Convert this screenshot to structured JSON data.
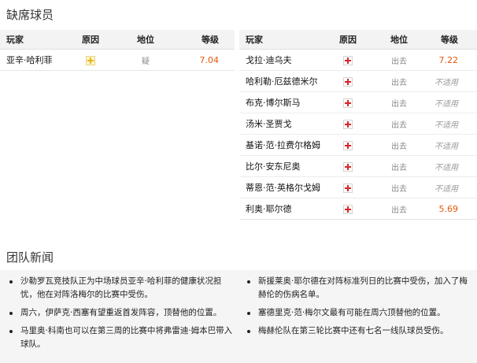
{
  "missing": {
    "title": "缺席球员",
    "headers": {
      "player": "玩家",
      "reason": "原因",
      "status": "地位",
      "rating": "等级"
    },
    "left": [
      {
        "name": "亚辛·哈利菲",
        "reason_icon": "yellow-cross-icon",
        "status": "疑",
        "rating": "7.04",
        "rating_type": "num"
      }
    ],
    "right": [
      {
        "name": "戈拉·迪乌夫",
        "reason_icon": "red-cross-icon",
        "status": "出去",
        "rating": "7.22",
        "rating_type": "num"
      },
      {
        "name": "哈利勒·厄兹德米尔",
        "reason_icon": "red-cross-icon",
        "status": "出去",
        "rating": "不适用",
        "rating_type": "na"
      },
      {
        "name": "布克·博尔斯马",
        "reason_icon": "red-cross-icon",
        "status": "出去",
        "rating": "不适用",
        "rating_type": "na"
      },
      {
        "name": "汤米·圣贾戈",
        "reason_icon": "red-cross-icon",
        "status": "出去",
        "rating": "不适用",
        "rating_type": "na"
      },
      {
        "name": "基诺·范·拉费尔格姆",
        "reason_icon": "red-cross-icon",
        "status": "出去",
        "rating": "不适用",
        "rating_type": "na"
      },
      {
        "name": "比尔·安东尼奥",
        "reason_icon": "red-cross-icon",
        "status": "出去",
        "rating": "不适用",
        "rating_type": "na"
      },
      {
        "name": "蒂恩·范·英格尔戈姆",
        "reason_icon": "red-cross-icon",
        "status": "出去",
        "rating": "不适用",
        "rating_type": "na"
      },
      {
        "name": "利奥·耶尔德",
        "reason_icon": "red-cross-icon",
        "status": "出去",
        "rating": "5.69",
        "rating_type": "num"
      }
    ]
  },
  "news": {
    "title": "团队新闻",
    "left": [
      "沙勒罗瓦竞技队正为中场球员亚辛·哈利菲的健康状况担忧，他在对阵洛梅尔的比赛中受伤。",
      "周六，伊萨克·西塞有望重返首发阵容，顶替他的位置。",
      "马里奥·科南也可以在第三周的比赛中将弗雷迪·姆本巴带入球队。"
    ],
    "right": [
      "新援莱奥·耶尔德在对阵标准列日的比赛中受伤，加入了梅赫伦的伤病名单。",
      "塞德里克·范·梅尔文最有可能在周六顶替他的位置。",
      "梅赫伦队在第三轮比赛中还有七名一线队球员受伤。"
    ]
  }
}
